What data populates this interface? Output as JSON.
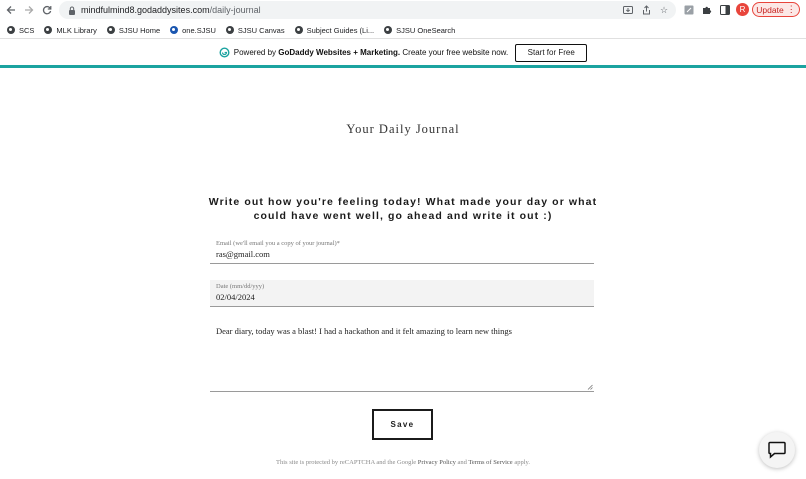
{
  "browser": {
    "url_host": "mindfulmind8.godaddysites.com",
    "url_path": "/daily-journal",
    "avatar_letter": "R",
    "update_label": "Update",
    "bookmarks": [
      {
        "label": "SCS",
        "icon": "globe-icon"
      },
      {
        "label": "MLK Library",
        "icon": "globe-icon"
      },
      {
        "label": "SJSU Home",
        "icon": "globe-icon"
      },
      {
        "label": "one.SJSU",
        "icon": "sjsu-icon"
      },
      {
        "label": "SJSU Canvas",
        "icon": "globe-icon"
      },
      {
        "label": "Subject Guides (Li...",
        "icon": "globe-icon"
      },
      {
        "label": "SJSU OneSearch",
        "icon": "globe-icon"
      }
    ]
  },
  "banner": {
    "prefix": "Powered by",
    "brand": "GoDaddy Websites + Marketing.",
    "suffix": "Create your free website now.",
    "cta": "Start for Free",
    "accent": "#1ba3a0"
  },
  "page": {
    "title": "Your Daily Journal",
    "prompt": "Write out how you're feeling today! What made your day or what could have went well, go ahead and write it out :)",
    "email_label": "Email (we'll email you a copy of your journal)*",
    "email_value": "ras@gmail.com",
    "date_label": "Date (mm/dd/yyy)",
    "date_value": "02/04/2024",
    "entry_value": "Dear diary, today was a blast! I had a hackathon and it felt amazing to learn new things",
    "save_label": "Save",
    "recaptcha_prefix": "This site is protected by reCAPTCHA and the Google",
    "privacy_link": "Privacy Policy",
    "and": "and",
    "terms_link": "Terms of Service",
    "apply": "apply."
  }
}
